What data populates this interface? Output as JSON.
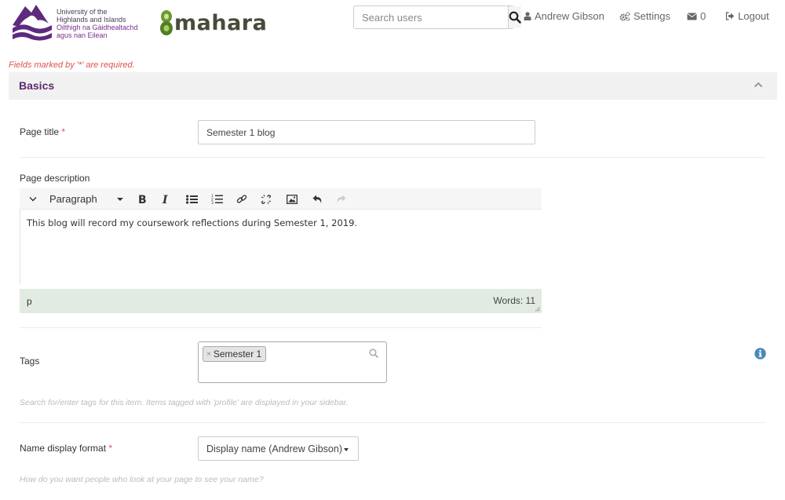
{
  "header": {
    "uhi_logo": {
      "line1": "University of the",
      "line2": "Highlands and Islands",
      "line3": "Oilthigh na Gàidhealtachd",
      "line4": "agus nan Eilean"
    },
    "mahara_logo": {
      "text": "mahara",
      "color": "#5b8c2a"
    },
    "search": {
      "placeholder": "Search users",
      "value": "",
      "icon": "search-icon"
    },
    "nav": {
      "user": {
        "label": "Andrew Gibson",
        "icon": "user-icon"
      },
      "settings": {
        "label": "Settings",
        "icon": "gears-icon"
      },
      "inbox": {
        "label": "0",
        "icon": "envelope-icon"
      },
      "logout": {
        "label": "Logout",
        "icon": "sign-out-icon"
      }
    }
  },
  "form": {
    "required_note": "Fields marked by '*' are required.",
    "section": {
      "title": "Basics",
      "expanded": true,
      "title_color": "#5b2b6e"
    },
    "page_title": {
      "label": "Page title",
      "required_marker": "*",
      "value": "Semester 1 blog"
    },
    "page_description": {
      "label": "Page description",
      "toolbar": {
        "format_select": "Paragraph",
        "buttons": [
          "toggle-toolbar",
          "bold",
          "italic",
          "bullet-list",
          "numbered-list",
          "link",
          "unlink",
          "image",
          "undo",
          "redo"
        ]
      },
      "content": "This blog will record my coursework reflections during Semester 1, 2019.",
      "status_path": "p",
      "word_count": "Words: 11",
      "status_bg": "#e2ebe1"
    },
    "tags": {
      "label": "Tags",
      "values": [
        "Semester 1"
      ],
      "remove_glyph": "×",
      "help": "Search for/enter tags for this item. Items tagged with 'profile' are displayed in your sidebar."
    },
    "name_display_format": {
      "label": "Name display format",
      "required_marker": "*",
      "selected": "Display name (Andrew Gibson)",
      "help": "How do you want people who look at your page to see your name?"
    }
  },
  "colors": {
    "required": "#d9534f",
    "info": "#4a8ab5",
    "section_bg": "#f1f1f1"
  }
}
